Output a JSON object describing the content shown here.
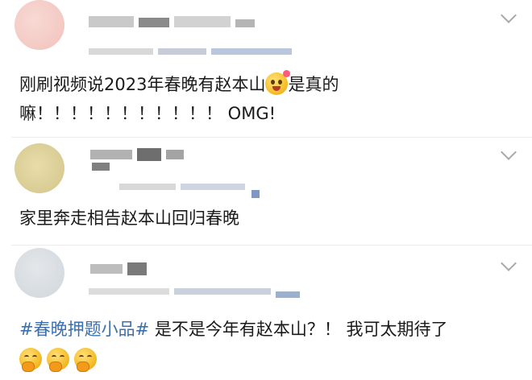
{
  "comments": [
    {
      "body_parts": [
        "刚刷视频说2023年春晚有赵本山",
        "是真的"
      ],
      "body_line2": "嘛！！！！！！！！！！！ OMG!",
      "inline_emoji": "tongue-wink-heart-emoji"
    },
    {
      "body": "家里奔走相告赵本山回归春晚"
    },
    {
      "hashtag": "#春晚押题小品#",
      "body": " 是不是今年有赵本山？！ 我可太期待了",
      "trailing_emoji": [
        "hug-face-emoji",
        "hug-face-emoji",
        "hug-face-emoji"
      ]
    }
  ],
  "colors": {
    "link": "#3a6fb0",
    "separator": "#ececec",
    "chevron": "#a8a8a8"
  }
}
